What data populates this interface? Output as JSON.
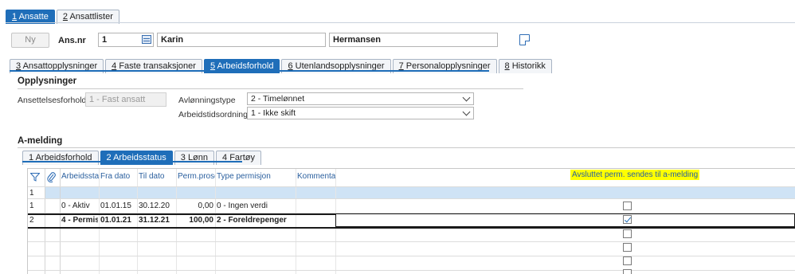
{
  "top_tabs": [
    {
      "num": "1",
      "label": "Ansatte",
      "active": true
    },
    {
      "num": "2",
      "label": "Ansattlister",
      "active": false
    }
  ],
  "header": {
    "new_button": "Ny",
    "ansnr_label": "Ans.nr",
    "ansnr_value": "1",
    "first_name": "Karin",
    "last_name": "Hermansen"
  },
  "sub_tabs": [
    {
      "num": "3",
      "label": "Ansattopplysninger",
      "active": false
    },
    {
      "num": "4",
      "label": "Faste transaksjoner",
      "active": false
    },
    {
      "num": "5",
      "label": "Arbeidsforhold",
      "active": true
    },
    {
      "num": "6",
      "label": "Utenlandsopplysninger",
      "active": false
    },
    {
      "num": "7",
      "label": "Personalopplysninger",
      "active": false
    },
    {
      "num": "8",
      "label": "Historikk",
      "active": false
    }
  ],
  "opplysninger": {
    "title": "Opplysninger",
    "ansettelsesforhold_label": "Ansettelsesforhold",
    "ansettelsesforhold_value": "1 - Fast ansatt",
    "avlonningstype_label": "Avlønningstype",
    "avlonningstype_value": "2 - Timelønnet",
    "arbeidstidsordning_label": "Arbeidstidsordning",
    "arbeidstidsordning_value": "1 - Ikke skift"
  },
  "amelding": {
    "title": "A-melding",
    "tabs": [
      {
        "num": "1",
        "label": "Arbeidsforhold",
        "active": false
      },
      {
        "num": "2",
        "label": "Arbeidsstatus",
        "active": true
      },
      {
        "num": "3",
        "label": "Lønn",
        "active": false
      },
      {
        "num": "4",
        "label": "Fartøy",
        "active": false
      }
    ],
    "columns": [
      "Arbeidsstat",
      "Fra dato",
      "Til dato",
      "Perm.prose",
      "Type permisjon",
      "Kommentar"
    ],
    "highlight_column": "Avsluttet perm. sendes til a-melding",
    "rows": [
      {
        "num": "1",
        "status": "",
        "fra": "",
        "til": "",
        "perm": "",
        "type": "",
        "checked": null
      },
      {
        "num": "1",
        "status": "0 - Aktiv",
        "fra": "01.01.15",
        "til": "30.12.20",
        "perm": "0,00",
        "type": "0 - Ingen verdi",
        "checked": false
      },
      {
        "num": "2",
        "status": "4 - Permis",
        "fra": "01.01.21",
        "til": "31.12.21",
        "perm": "100,00",
        "type": "2 - Foreldrepenger",
        "checked": true
      }
    ],
    "empty_checkbox_rows": 4
  },
  "colors": {
    "accent": "#1f6eb9",
    "highlight": "#ffff00",
    "selected_row": "#cfe3f5"
  }
}
